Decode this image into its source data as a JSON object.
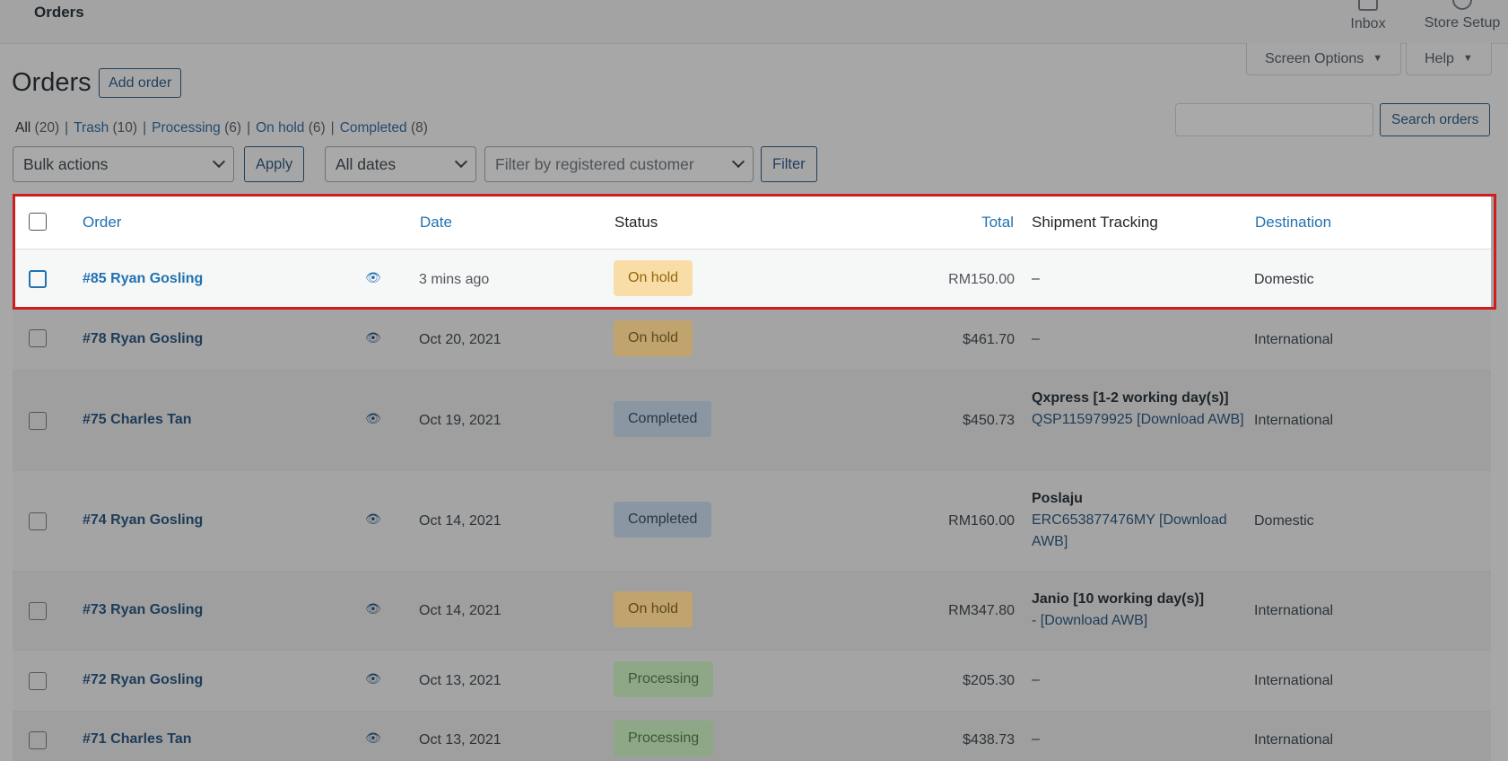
{
  "topbar": {
    "breadcrumb": "Orders",
    "inbox_label": "Inbox",
    "setup_label": "Store Setup"
  },
  "screen_options": {
    "label": "Screen Options",
    "help": "Help"
  },
  "header": {
    "title": "Orders",
    "add_order": "Add order"
  },
  "views": [
    {
      "label": "All",
      "count": "(20)"
    },
    {
      "label": "Trash",
      "count": "(10)"
    },
    {
      "label": "Processing",
      "count": "(6)"
    },
    {
      "label": "On hold",
      "count": "(6)"
    },
    {
      "label": "Completed",
      "count": "(8)"
    }
  ],
  "search": {
    "placeholder": "",
    "button": "Search orders"
  },
  "filters": {
    "bulk_actions": "Bulk actions",
    "apply": "Apply",
    "dates": "All dates",
    "customer_placeholder": "Filter by registered customer",
    "filter": "Filter"
  },
  "table": {
    "columns": {
      "order": "Order",
      "date": "Date",
      "status": "Status",
      "total": "Total",
      "tracking": "Shipment Tracking",
      "destination": "Destination"
    },
    "rows": [
      {
        "order": "#85 Ryan Gosling",
        "date": "3 mins ago",
        "status": "On hold",
        "total": "RM150.00",
        "tracking_carrier": "",
        "tracking_code": "–",
        "destination": "Domestic"
      },
      {
        "order": "#78 Ryan Gosling",
        "date": "Oct 20, 2021",
        "status": "On hold",
        "total": "$461.70",
        "tracking_carrier": "",
        "tracking_code": "–",
        "destination": "International"
      },
      {
        "order": "#75 Charles Tan",
        "date": "Oct 19, 2021",
        "status": "Completed",
        "total": "$450.73",
        "tracking_carrier": "Qxpress [1-2 working day(s)]",
        "tracking_code": "QSP115979925 [Download AWB]",
        "destination": "International"
      },
      {
        "order": "#74 Ryan Gosling",
        "date": "Oct 14, 2021",
        "status": "Completed",
        "total": "RM160.00",
        "tracking_carrier": "Poslaju",
        "tracking_code": "ERC653877476MY [Download AWB]",
        "destination": "Domestic"
      },
      {
        "order": "#73 Ryan Gosling",
        "date": "Oct 14, 2021",
        "status": "On hold",
        "total": "RM347.80",
        "tracking_carrier": "Janio [10 working day(s)]",
        "tracking_code": "- [Download AWB]",
        "destination": "International"
      },
      {
        "order": "#72 Ryan Gosling",
        "date": "Oct 13, 2021",
        "status": "Processing",
        "total": "$205.30",
        "tracking_carrier": "",
        "tracking_code": "–",
        "destination": "International"
      },
      {
        "order": "#71 Charles Tan",
        "date": "Oct 13, 2021",
        "status": "Processing",
        "total": "$438.73",
        "tracking_carrier": "",
        "tracking_code": "–",
        "destination": "International"
      }
    ]
  },
  "colors": {
    "highlight_border": "#d01d1d",
    "link": "#2271b1",
    "on_hold_bg": "#f8dda7",
    "completed_bg": "#c5d9ed",
    "processing_bg": "#c6e1c6"
  }
}
